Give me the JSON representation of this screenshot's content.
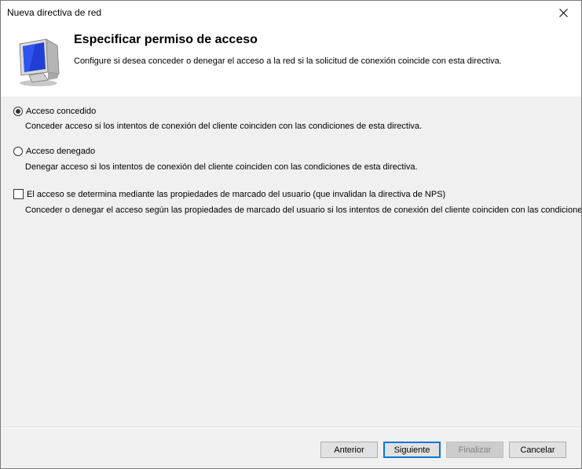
{
  "window": {
    "title": "Nueva directiva de red",
    "close_glyph": "✕"
  },
  "header": {
    "title": "Especificar permiso de acceso",
    "description": "Configure si desea conceder o denegar el acceso a la red si la solicitud de conexión coincide con esta directiva.",
    "icon": "network-computer-icon"
  },
  "options": {
    "granted": {
      "label": "Acceso concedido",
      "description": "Conceder acceso si los intentos de conexión del cliente coinciden con las condiciones de esta directiva.",
      "checked": true
    },
    "denied": {
      "label": "Acceso denegado",
      "description": "Denegar acceso si los intentos de conexión del cliente coinciden con las condiciones de esta directiva.",
      "checked": false
    },
    "dialin": {
      "label": "El acceso se determina mediante las propiedades de marcado del usuario (que invalidan la directiva de NPS)",
      "description": "Conceder o denegar el acceso según las propiedades de marcado del usuario si los intentos de conexión del cliente coinciden con las condiciones de esta directiva.",
      "checked": false
    }
  },
  "buttons": {
    "back": "Anterior",
    "next": "Siguiente",
    "finish": "Finalizar",
    "cancel": "Cancelar"
  },
  "colors": {
    "accent": "#0078d7",
    "window_bg": "#f0f0f0",
    "header_bg": "#ffffff"
  }
}
